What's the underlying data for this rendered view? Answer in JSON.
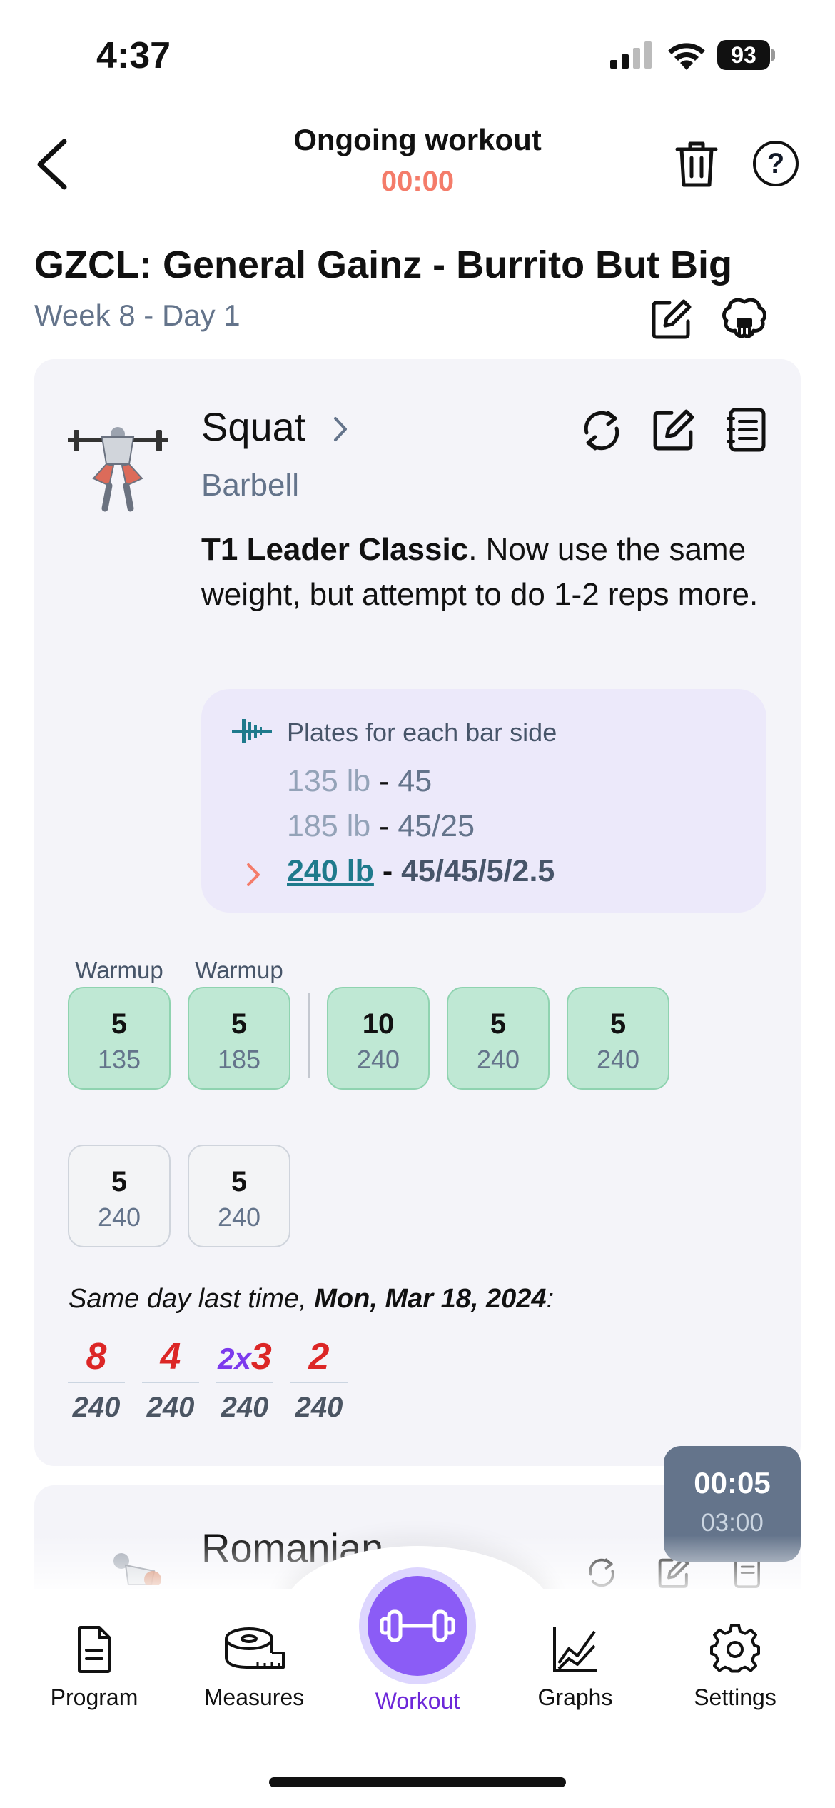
{
  "status_bar": {
    "time": "4:37",
    "battery": "93"
  },
  "header": {
    "title": "Ongoing workout",
    "timer": "00:00"
  },
  "program": {
    "title": "GZCL: General Gainz - Burrito But Big",
    "subtitle": "Week 8 - Day 1"
  },
  "exercise": {
    "name": "Squat",
    "equipment": "Barbell",
    "desc_bold": "T1 Leader Classic",
    "desc_rest": ". Now use the same weight, but attempt to do 1-2 reps more.",
    "plates": {
      "title": "Plates for each bar side",
      "rows": [
        {
          "weight": "135 lb",
          "sep": " - ",
          "plates": "45"
        },
        {
          "weight": "185 lb",
          "sep": " - ",
          "plates": "45/25"
        },
        {
          "weight": "240 lb",
          "sep": " - ",
          "plates": "45/45/5/2.5"
        }
      ]
    },
    "warmup_labels": [
      "Warmup",
      "Warmup"
    ],
    "sets": [
      {
        "reps": "5",
        "weight": "135"
      },
      {
        "reps": "5",
        "weight": "185"
      },
      {
        "reps": "10",
        "weight": "240"
      },
      {
        "reps": "5",
        "weight": "240"
      },
      {
        "reps": "5",
        "weight": "240"
      },
      {
        "reps": "5",
        "weight": "240"
      },
      {
        "reps": "5",
        "weight": "240"
      }
    ],
    "last_time": {
      "prefix": "Same day last time, ",
      "date": "Mon, Mar 18, 2024",
      "suffix": ":",
      "history": [
        {
          "mult": "",
          "reps": "8",
          "weight": "240"
        },
        {
          "mult": "",
          "reps": "4",
          "weight": "240"
        },
        {
          "mult": "2x",
          "reps": "3",
          "weight": "240"
        },
        {
          "mult": "",
          "reps": "2",
          "weight": "240"
        }
      ]
    }
  },
  "rest_timer": {
    "elapsed": "00:05",
    "total": "03:00"
  },
  "next_exercise": {
    "name": "Romanian"
  },
  "nav": {
    "program": "Program",
    "measures": "Measures",
    "workout": "Workout",
    "graphs": "Graphs",
    "settings": "Settings"
  },
  "colors": {
    "accent": "#8b5cf6",
    "timer": "#f47c6a",
    "completed_set": "#bfe8d4",
    "plates_bg": "#ece9fa",
    "history_reps": "#dc2626"
  }
}
